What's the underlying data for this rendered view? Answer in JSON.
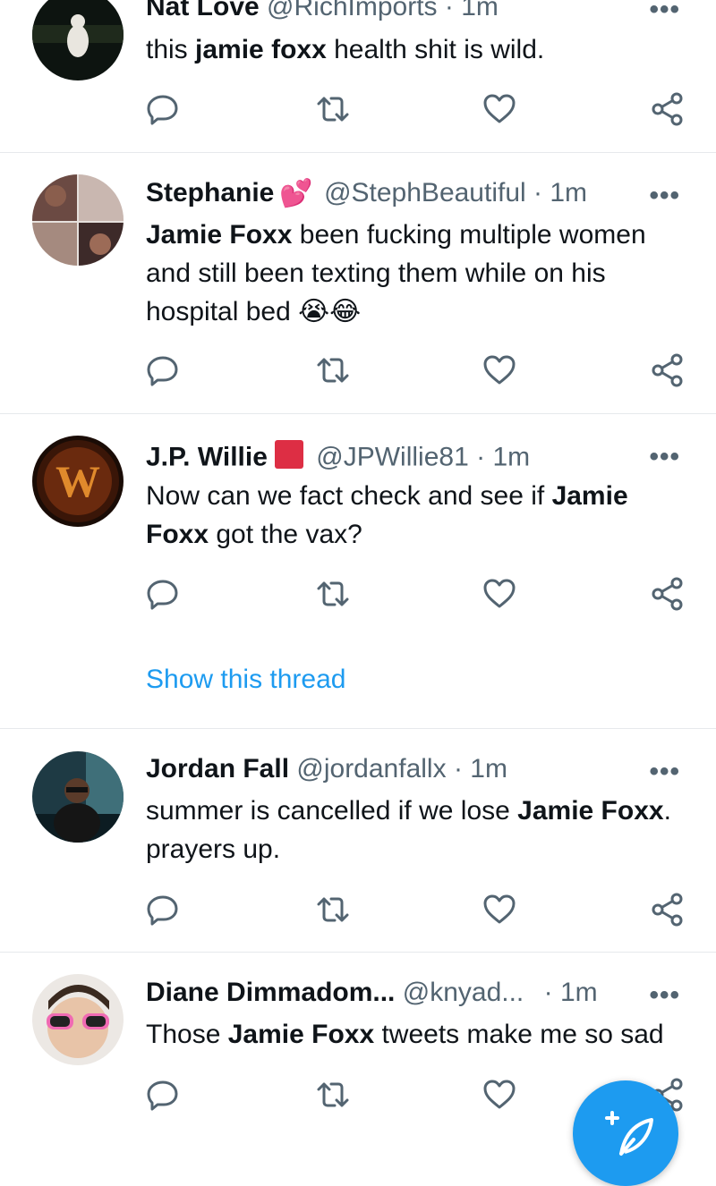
{
  "tweets": [
    {
      "name": "Nat Love",
      "handle": "@RichImports",
      "sep": "·",
      "time": "1m",
      "body": [
        {
          "t": "this "
        },
        {
          "t": "jamie foxx",
          "b": true
        },
        {
          "t": " health shit is wild."
        }
      ]
    },
    {
      "name": "Stephanie",
      "badge": "💕",
      "handle": "@StephBeautiful",
      "sep": "·",
      "time": "1m",
      "body": [
        {
          "t": "Jamie Foxx",
          "b": true
        },
        {
          "t": " been fucking multiple women and still been texting them while on his hospital bed 😭😂"
        }
      ]
    },
    {
      "name": "J.P. Willie",
      "badge": "🟥",
      "handle": "@JPWillie81",
      "sep": "·",
      "time": "1m",
      "body": [
        {
          "t": "Now can we fact check and see if "
        },
        {
          "t": "Jamie Foxx",
          "b": true
        },
        {
          "t": " got the vax?"
        }
      ],
      "show_thread": "Show this thread"
    },
    {
      "name": "Jordan Fall",
      "handle": "@jordanfallx",
      "sep": "·",
      "time": "1m",
      "body": [
        {
          "t": "summer is cancelled if we lose "
        },
        {
          "t": "Jamie Foxx",
          "b": true
        },
        {
          "t": ". prayers up."
        }
      ]
    },
    {
      "name": "Diane Dimmadom...",
      "handle": "@knyad...",
      "sep": "·",
      "time": "1m",
      "body": [
        {
          "t": "Those "
        },
        {
          "t": "Jamie Foxx",
          "b": true
        },
        {
          "t": " tweets make me so sad"
        }
      ]
    }
  ],
  "more_label": "•••",
  "icons": {
    "reply": "reply-icon",
    "retweet": "retweet-icon",
    "like": "like-icon",
    "share": "share-icon",
    "compose": "compose-icon"
  },
  "colors": {
    "accent": "#1d9bf0",
    "muted": "#536471",
    "text": "#0f1419",
    "divider": "#e6e9ec"
  }
}
